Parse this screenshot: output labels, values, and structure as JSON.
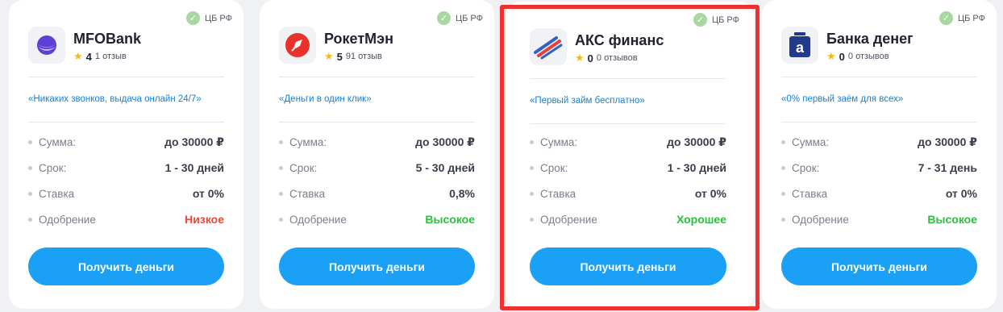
{
  "offers": [
    {
      "cb_label": "ЦБ РФ",
      "name": "MFOBank",
      "rating": "4",
      "reviews": "1 отзыв",
      "slogan": "«Никаких звонков, выдача онлайн 24/7»",
      "rows": [
        {
          "label": "Сумма:",
          "value": "до 30000 ₽"
        },
        {
          "label": "Срок:",
          "value": "1 - 30 дней"
        },
        {
          "label": "Ставка",
          "value": "от 0%"
        },
        {
          "label": "Одобрение",
          "value": "Низкое"
        }
      ],
      "button": "Получить деньги"
    },
    {
      "cb_label": "ЦБ РФ",
      "name": "РокетМэн",
      "rating": "5",
      "reviews": "91 отзыв",
      "slogan": "«Деньги в один клик»",
      "rows": [
        {
          "label": "Сумма:",
          "value": "до 30000 ₽"
        },
        {
          "label": "Срок:",
          "value": "5 - 30 дней"
        },
        {
          "label": "Ставка",
          "value": "0,8%"
        },
        {
          "label": "Одобрение",
          "value": "Высокое"
        }
      ],
      "button": "Получить деньги"
    },
    {
      "cb_label": "ЦБ РФ",
      "name": "АКС финанс",
      "rating": "0",
      "reviews": "0 отзывов",
      "slogan": "«Первый займ бесплатно»",
      "rows": [
        {
          "label": "Сумма:",
          "value": "до 30000 ₽"
        },
        {
          "label": "Срок:",
          "value": "1 - 30 дней"
        },
        {
          "label": "Ставка",
          "value": "от 0%"
        },
        {
          "label": "Одобрение",
          "value": "Хорошее"
        }
      ],
      "button": "Получить деньги"
    },
    {
      "cb_label": "ЦБ РФ",
      "name": "Банка денег",
      "rating": "0",
      "reviews": "0 отзывов",
      "slogan": "«0% первый заём для всех»",
      "rows": [
        {
          "label": "Сумма:",
          "value": "до 30000 ₽"
        },
        {
          "label": "Срок:",
          "value": "7 - 31 день"
        },
        {
          "label": "Ставка",
          "value": "от 0%"
        },
        {
          "label": "Одобрение",
          "value": "Высокое"
        }
      ],
      "button": "Получить деньги"
    }
  ],
  "colors": {
    "accent_button": "#1aa0f5",
    "slogan": "#1a7fd6",
    "approval_low": "#e84a3c",
    "approval_high": "#2cbf3e",
    "highlight_frame": "#f0312e"
  }
}
